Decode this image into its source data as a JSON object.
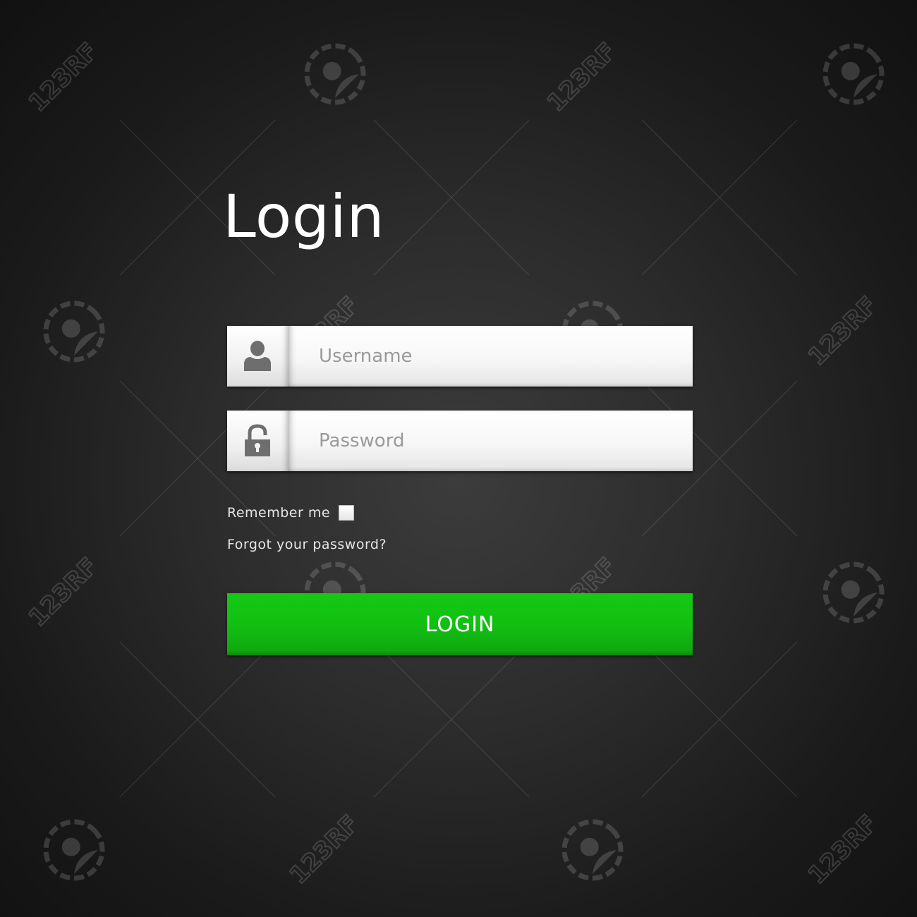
{
  "title": "Login",
  "username": {
    "placeholder": "Username",
    "value": "",
    "icon": "user-icon"
  },
  "password": {
    "placeholder": "Password",
    "value": "",
    "icon": "lock-icon"
  },
  "remember_me": {
    "label": "Remember me",
    "checked": false
  },
  "forgot_password": {
    "label": "Forgot your password?"
  },
  "login_button": {
    "label": "LOGIN"
  },
  "colors": {
    "background": "#2c2c2c",
    "title": "#ffffff",
    "button": "#12c012",
    "button_text": "#ffffff",
    "field_icon": "#6e6e6e"
  },
  "watermark": {
    "text": "123RF"
  }
}
